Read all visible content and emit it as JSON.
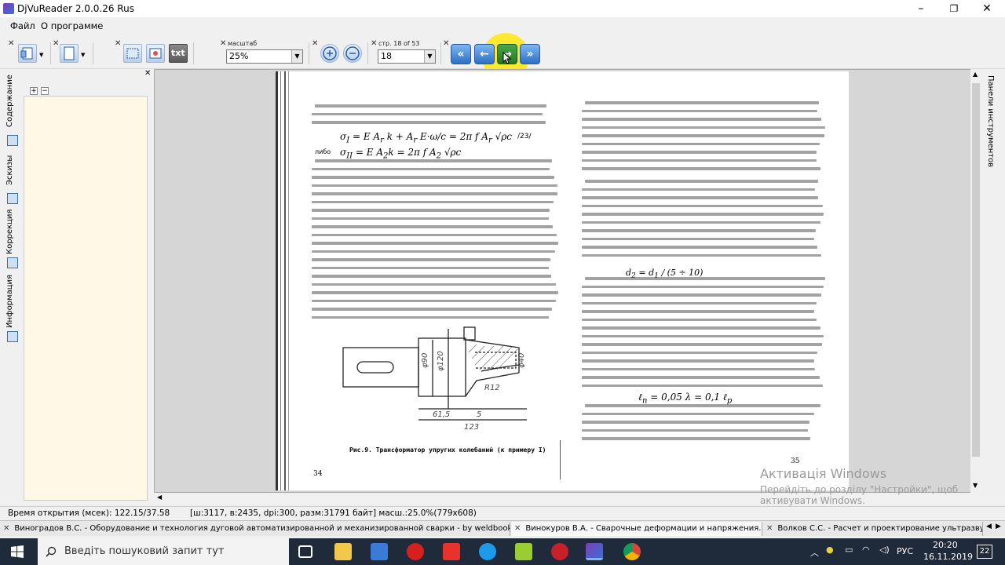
{
  "window": {
    "title": "DjVuReader 2.0.0.26 Rus"
  },
  "menu": {
    "file": "Файл",
    "about": "О программе"
  },
  "toolbar": {
    "scale_label": "масштаб",
    "scale_value": "25%",
    "page_label": "стр. 18 of 53",
    "page_value": "18",
    "txt_label": "txt"
  },
  "left_panel": {
    "tabs": [
      "Содержание",
      "Эскизы",
      "Коррекция",
      "Информация"
    ]
  },
  "right_panel": {
    "label": "Панели инструментов"
  },
  "document": {
    "left_page_number": "34",
    "right_page_number": "35",
    "figure_caption": "Рис.9. Трансформатор упругих колебаний (к примеру I)",
    "dims": [
      "φ90",
      "φ120",
      "φ40",
      "R12",
      "61,5",
      "5",
      "123"
    ]
  },
  "status": {
    "open_time": "Время открытия (мсек): 122.15/37.58",
    "info": "[ш:3117, в:2435, dpi:300, разм:31791 байт] масш.:25.0%(779x608)"
  },
  "doc_tabs": [
    "Виноградов В.С. - Оборудование и технология дуговой автоматизированной и механизированной сварки - by weldbook.zxq.net.djvu",
    "Винокуров В.А. - Сварочные деформации и напряжения.djvu",
    "Волков С.С. - Расчет и проектирование ультразвук"
  ],
  "watermark": {
    "title": "Активація Windows",
    "line1": "Перейдіть до розділу \"Настройки\", щоб",
    "line2": "активувати Windows."
  },
  "taskbar": {
    "search_placeholder": "Введіть пошуковий запит тут",
    "lang": "РУС",
    "time": "20:20",
    "date": "16.11.2019",
    "notifications": "22"
  }
}
